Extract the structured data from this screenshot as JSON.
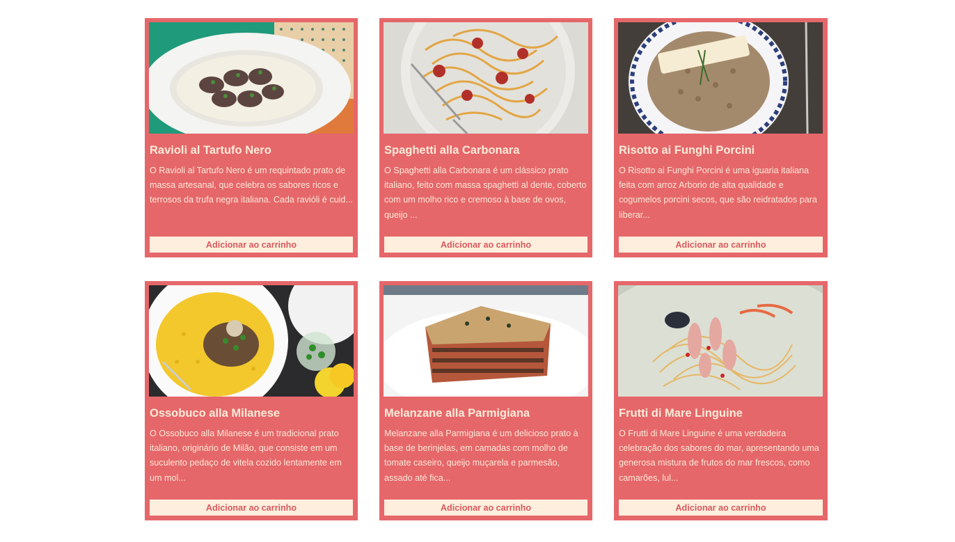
{
  "button_label": "Adicionar ao carrinho",
  "colors": {
    "card_background": "#e5676a",
    "title_text": "#fdebd8",
    "button_background": "#fdeedd",
    "button_text": "#d95a5f"
  },
  "dishes": [
    {
      "title": "Ravioli al Tartufo Nero",
      "description": "O Ravioli al Tartufo Nero é um requintado prato de massa artesanal, que celebra os sabores ricos e terrosos da trufa negra italiana. Cada ravióli é cuid..."
    },
    {
      "title": "Spaghetti alla Carbonara",
      "description": "O Spaghetti alla Carbonara é um clássico prato italiano, feito com massa spaghetti al dente, coberto com um molho rico e cremoso à base de ovos, queijo ..."
    },
    {
      "title": "Risotto ai Funghi Porcini",
      "description": "O Risotto ai Funghi Porcini é uma iguaria italiana feita com arroz Arborio de alta qualidade e cogumelos porcini secos, que são reidratados para liberar..."
    },
    {
      "title": "Ossobuco alla Milanese",
      "description": "O Ossobuco alla Milanese é um tradicional prato italiano, originário de Milão, que consiste em um suculento pedaço de vitela cozido lentamente em um mol..."
    },
    {
      "title": "Melanzane alla Parmigiana",
      "description": "Melanzane alla Parmigiana é um delicioso prato à base de berinjelas, em camadas com molho de tomate caseiro, queijo muçarela e parmesão, assado até fica..."
    },
    {
      "title": "Frutti di Mare Linguine",
      "description": "O Frutti di Mare Linguine é uma verdadeira celebração dos sabores do mar, apresentando uma generosa mistura de frutos do mar frescos, como camarões, lul..."
    }
  ]
}
